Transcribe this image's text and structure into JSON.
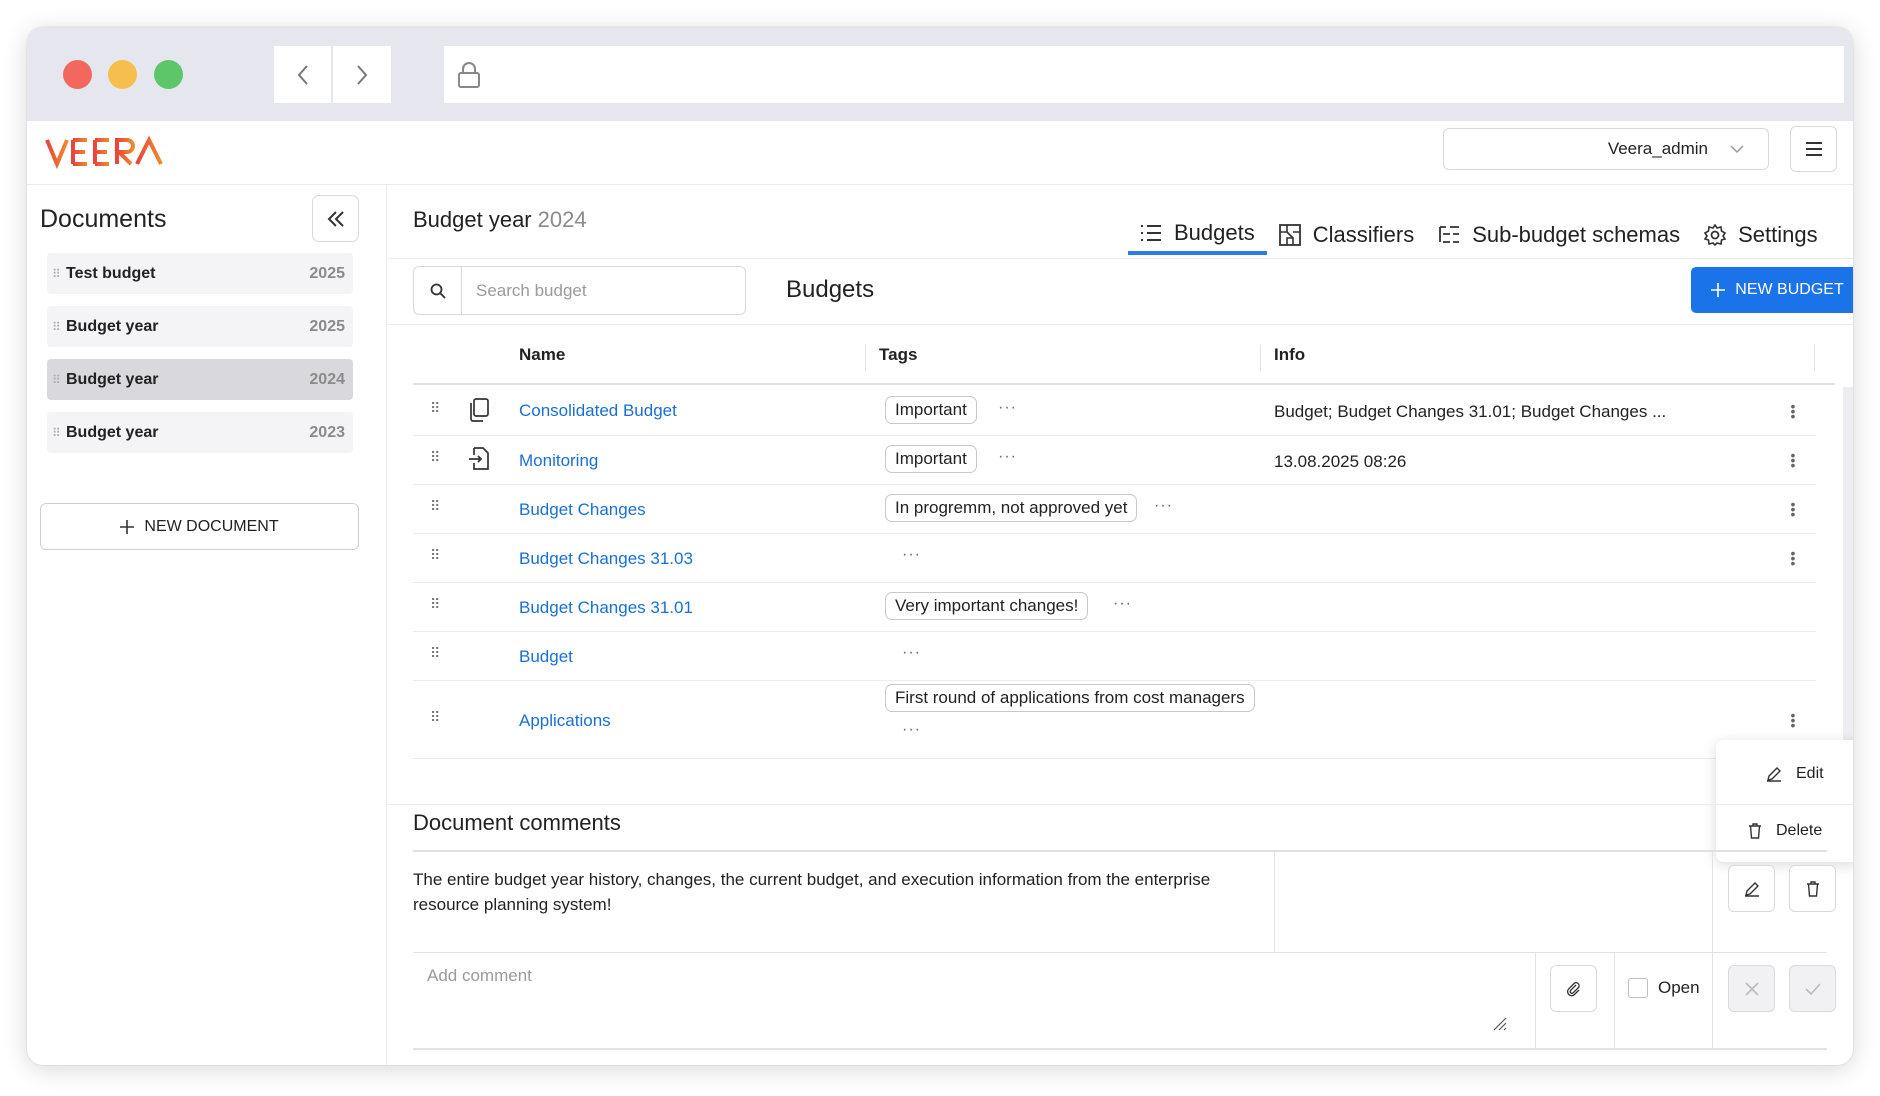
{
  "browser": {
    "url": ""
  },
  "header": {
    "logo_text": "VEERA",
    "user": "Veera_admin"
  },
  "sidebar": {
    "title": "Documents",
    "items": [
      {
        "name": "Test budget",
        "year": "2025",
        "active": false
      },
      {
        "name": "Budget year",
        "year": "2025",
        "active": false
      },
      {
        "name": "Budget year",
        "year": "2024",
        "active": true
      },
      {
        "name": "Budget year",
        "year": "2023",
        "active": false
      }
    ],
    "new_document_label": "NEW DOCUMENT"
  },
  "page": {
    "title": "Budget year",
    "year": "2024"
  },
  "tabs": [
    {
      "label": "Budgets",
      "icon": "list-icon",
      "active": true
    },
    {
      "label": "Classifiers",
      "icon": "classifier-icon",
      "active": false
    },
    {
      "label": "Sub-budget schemas",
      "icon": "schema-icon",
      "active": false
    },
    {
      "label": "Settings",
      "icon": "gear-icon",
      "active": false
    }
  ],
  "search": {
    "placeholder": "Search budget",
    "value": ""
  },
  "section_title": "Budgets",
  "new_budget_label": "NEW BUDGET",
  "table": {
    "columns": [
      "Name",
      "Tags",
      "Info"
    ],
    "rows": [
      {
        "name": "Consolidated Budget",
        "icon": "copy-icon",
        "tags": [
          "Important"
        ],
        "info": "Budget; Budget Changes 31.01; Budget Changes ..."
      },
      {
        "name": "Monitoring",
        "icon": "import-icon",
        "tags": [
          "Important"
        ],
        "info": "13.08.2025 08:26"
      },
      {
        "name": "Budget Changes",
        "icon": "",
        "tags": [
          "In progremm, not approved yet"
        ],
        "info": ""
      },
      {
        "name": "Budget Changes 31.03",
        "icon": "",
        "tags": [],
        "info": ""
      },
      {
        "name": "Budget Changes 31.01",
        "icon": "",
        "tags": [
          "Very important changes!"
        ],
        "info": ""
      },
      {
        "name": "Budget",
        "icon": "",
        "tags": [],
        "info": ""
      },
      {
        "name": "Applications",
        "icon": "",
        "tags": [
          "First round of applications from cost managers"
        ],
        "info": ""
      }
    ]
  },
  "context_menu": {
    "edit": "Edit",
    "delete": "Delete"
  },
  "comments": {
    "title": "Document comments",
    "text": "The entire budget year history, changes, the current budget, and execution information from the enterprise resource planning system!",
    "add_placeholder": "Add comment",
    "open_label": "Open"
  },
  "colors": {
    "accent": "#1a73e8",
    "link": "#1a6fd4",
    "logo_red": "#e8453c",
    "logo_orange": "#f08a2e"
  }
}
